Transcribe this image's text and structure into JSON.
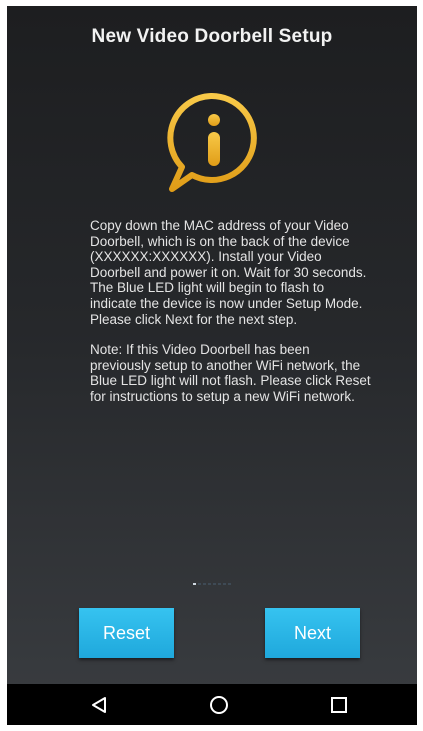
{
  "header": {
    "title": "New Video Doorbell Setup"
  },
  "info_icon": {
    "name": "info-speech-bubble-icon",
    "color": "#f0b52a"
  },
  "instructions": {
    "paragraph_1": "Copy down the MAC address of your Video Doorbell, which is on the back of the device (XXXXXX:XXXXXX). Install your Video Doorbell and power it on. Wait for 30 seconds. The Blue LED light will begin to flash to indicate the device is now under Setup Mode. Please click Next for the next step.",
    "paragraph_2": "Note: If this Video Doorbell has been previously setup to another WiFi network, the Blue LED light will not flash. Please click Reset for instructions to setup a new WiFi network."
  },
  "page_indicator": {
    "total": 8,
    "current": 1
  },
  "buttons": {
    "reset_label": "Reset",
    "next_label": "Next",
    "color": "#29b6e8"
  },
  "navigation_bar": {
    "back_icon": "back-triangle-icon",
    "home_icon": "home-circle-icon",
    "recents_icon": "recents-square-icon"
  }
}
